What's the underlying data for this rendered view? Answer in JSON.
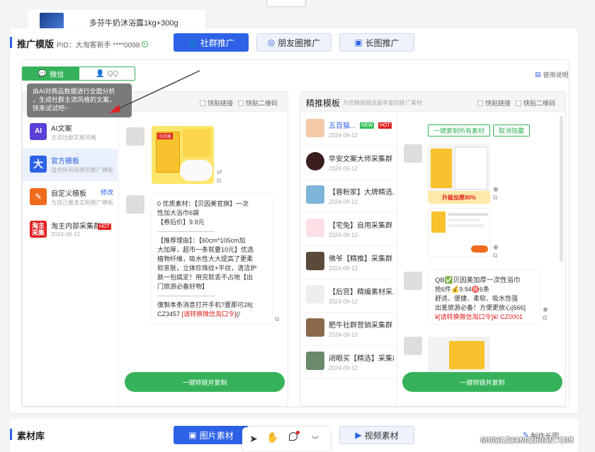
{
  "top": {
    "product_title": "多芬牛奶沐浴露1kg+300g"
  },
  "promo": {
    "title": "推广模版",
    "pid": "PID：大淘客新手 ****0098",
    "tabs": [
      {
        "label": "社群推广",
        "active": true
      },
      {
        "label": "朋友圈推广",
        "active": false
      },
      {
        "label": "长图推广",
        "active": false
      }
    ],
    "platform": {
      "wechat": "微信",
      "qq": "QQ"
    },
    "usage": "使用说明",
    "tooltip": [
      "由AI对商品数据进行全面分析",
      "，生成社群主流风格的文案，",
      "快来试试吧~"
    ],
    "left_options": {
      "quick_link": "快贴链接",
      "qr": "快贴二维码"
    },
    "menu": [
      {
        "icon": "AI",
        "title": "AI文案",
        "sub": "主流社群文案风格",
        "color": "#5b3fd6"
      },
      {
        "icon": "大",
        "title": "官方模板",
        "sub": "适合所有场景的推广模板",
        "color": "#2d62e6"
      },
      {
        "icon": "✎",
        "title": "自定义模板",
        "edit": "修改",
        "sub": "为自己量身定制推广模板",
        "color": "#f06a1c"
      },
      {
        "icon": "淘主采集",
        "title": "淘主内部采集群",
        "badge": "HOT",
        "date": "2024-09-12",
        "color": "#e02020"
      }
    ],
    "left_message": [
      "0 优质素材：【贝因美官旗】一次",
      "性加大浴巾6袋",
      "【券后价】9.9元",
      "---------------------------",
      "【推荐理由】：【60cm*105cm加",
      "大加厚，超市一条就要10元】优选",
      "植物纤维，吸水性大大提高了更柔",
      "软亲肤，立体珍珠纹+平纹，清洁护",
      "肤一包搞定！用完就丢不占地【出",
      "门旅游必备好物】",
      "---------------------------",
      " 復製本条消息打开手机?置那可28(",
      "CZ3457 "
    ],
    "left_message_red": "[请转换微信淘口令]",
    "left_message_tail": "(/",
    "convert_btn": "一键转链并复制",
    "right_title": "精推模板",
    "right_sub": "为您精挑细选最丰富的推广素材",
    "right_options": {
      "quick_link": "快贴链接",
      "qr": "快贴二维码"
    },
    "copy_all": "一键复制所有素材",
    "cancel_hide": "取消隐藏",
    "groups": [
      {
        "name": "五百猫...",
        "date": "2024-09-12",
        "new": "NEW",
        "hot": "HOT"
      },
      {
        "name": "早安文案大师采集群",
        "date": "2024-09-12"
      },
      {
        "name": "【蓉粉家】大牌精选...",
        "date": "2024-09-12"
      },
      {
        "name": "【宅兔】自用采集群",
        "date": "2024-09-12"
      },
      {
        "name": "佛爷【精推】采集群",
        "date": "2024-09-12"
      },
      {
        "name": "【后宫】精编素材采...",
        "date": "2024-09-12"
      },
      {
        "name": "肥牛社群营销采集群",
        "date": "2024-09-12"
      },
      {
        "name": "闭眼买【精选】采集群",
        "date": "2024-09-12"
      }
    ],
    "right_message": [
      "QB✅贝因美加厚一次性浴巾",
      "抢6件💰9.94🉐6条",
      "舒适、便捷、柔软、吸水性强",
      "出差旅游必备！方便更放心[666]"
    ],
    "right_message_red": "¥[请转换微信淘口令]¥/ CZ0001",
    "product_banner": "升级加厚80%",
    "badge_text": "贝因美",
    "convert_btn2": "一键转链并复制"
  },
  "material": {
    "title": "素材库",
    "tabs": [
      {
        "label": "图片素材",
        "active": true
      },
      {
        "label": "视频素材",
        "active": false
      }
    ],
    "make_long": "制作长图"
  },
  "watermark": "GUOWAIWANGZHUAN.COM"
}
